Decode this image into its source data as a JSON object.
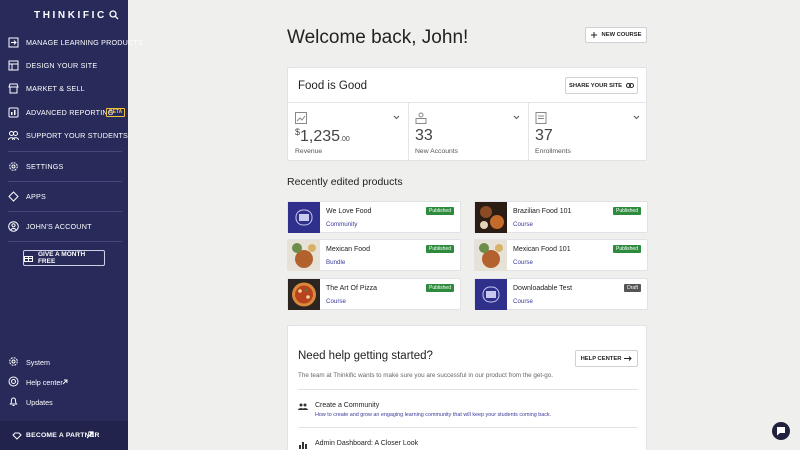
{
  "sidebar": {
    "brand": "THINKIFIC",
    "nav": [
      {
        "label": "Manage Learning Products",
        "icon": "square-arrow-icon"
      },
      {
        "label": "Design Your Site",
        "icon": "layout-icon"
      },
      {
        "label": "Market & Sell",
        "icon": "storefront-icon"
      },
      {
        "label": "Advanced Reporting",
        "icon": "report-icon",
        "badge": "BETA"
      },
      {
        "label": "Support Your Students",
        "icon": "students-icon"
      },
      {
        "label": "Settings",
        "icon": "gear-icon"
      },
      {
        "label": "Apps",
        "icon": "apps-icon"
      },
      {
        "label": "John's Account",
        "icon": "user-icon"
      }
    ],
    "gift_label": "Give a Month Free",
    "footer": [
      {
        "label": "System",
        "icon": "gear-icon"
      },
      {
        "label": "Help center",
        "icon": "lifebuoy-icon"
      },
      {
        "label": "Updates",
        "icon": "bell-icon"
      }
    ],
    "partner_label": "BECOME A PARTNER"
  },
  "main": {
    "welcome": "Welcome back, John!",
    "new_course_label": "NEW COURSE",
    "site": {
      "title": "Food is Good",
      "share_label": "SHARE YOUR SITE",
      "stats": [
        {
          "currency": "$",
          "value": "1,235",
          "cents": ".00",
          "label": "Revenue"
        },
        {
          "value": "33",
          "label": "New Accounts"
        },
        {
          "value": "37",
          "label": "Enrollments"
        }
      ]
    },
    "recent_title": "Recently edited products",
    "products": [
      {
        "name": "We Love Food",
        "type": "Community",
        "status": "Published",
        "thumb": "community"
      },
      {
        "name": "Brazilian Food 101",
        "type": "Course",
        "status": "Published",
        "thumb": "food-dark"
      },
      {
        "name": "Mexican Food",
        "type": "Bundle",
        "status": "Published",
        "thumb": "food-light"
      },
      {
        "name": "Mexican Food 101",
        "type": "Course",
        "status": "Published",
        "thumb": "food-light"
      },
      {
        "name": "The Art Of Pizza",
        "type": "Course",
        "status": "Published",
        "thumb": "pizza"
      },
      {
        "name": "Downloadable Test",
        "type": "Course",
        "status": "Draft",
        "thumb": "community"
      }
    ],
    "help": {
      "title": "Need help getting started?",
      "button_label": "HELP CENTER",
      "description": "The team at Thinkific wants to make sure you are successful in our product from the get-go.",
      "items": [
        {
          "title": "Create a Community",
          "desc": "How to create and grow an engaging learning community that will keep your students coming back."
        },
        {
          "title": "Admin Dashboard: A Closer Look",
          "desc": ""
        }
      ]
    }
  },
  "colors": {
    "sidebar": "#282a5a",
    "published": "#2e8b3e",
    "draft": "#555555",
    "link": "#3a3a9a"
  }
}
